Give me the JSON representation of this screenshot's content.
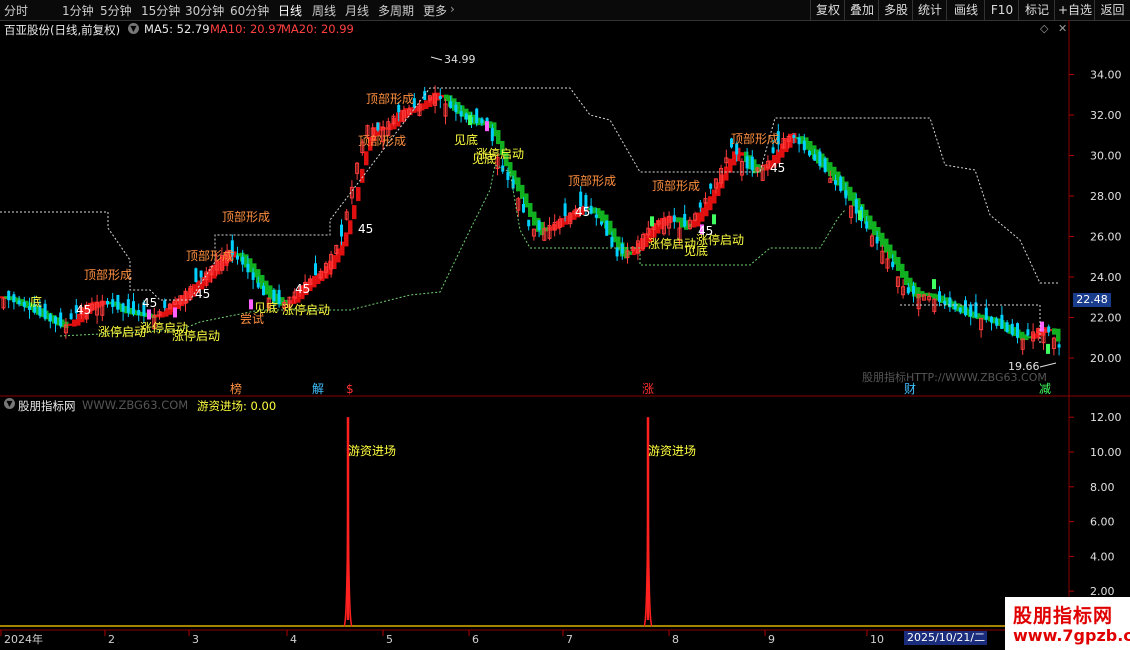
{
  "toolbar": {
    "timeframes": [
      "分时",
      "1分钟",
      "5分钟",
      "15分钟",
      "30分钟",
      "60分钟",
      "日线",
      "周线",
      "月线",
      "多周期",
      "更多"
    ],
    "active_timeframe": "日线",
    "right_buttons": [
      "复权",
      "叠加",
      "多股",
      "统计",
      "画线",
      "F10",
      "标记",
      "+自选",
      "返回"
    ]
  },
  "main_chart": {
    "title": "百亚股份(日线,前复权)",
    "ma5_label": "MA5: 52.79",
    "ma10_label": "MA10: 20.97",
    "ma20_label": "MA20: 20.99",
    "high_label": "34.99",
    "low_label": "19.66",
    "current_price": "22.48",
    "y_ticks": [
      "34.00",
      "32.00",
      "30.00",
      "28.00",
      "26.00",
      "24.00",
      "22.00",
      "20.00"
    ],
    "watermark_text": "股朋指标HTTP://WWW.ZBG63.COM",
    "event_markers": [
      "榜",
      "解",
      "$",
      "涨",
      "财",
      "减"
    ],
    "annotations": [
      "顶部形成",
      "顶部形成",
      "顶部形成",
      "顶部形成",
      "顶部形成",
      "顶部形成",
      "顶部形成",
      "顶部形成",
      "涨停启动",
      "涨停启动",
      "涨停启动",
      "涨停启动",
      "涨停启动",
      "涨停启动",
      "涨停启动",
      "见底",
      "见底",
      "见底",
      "见底",
      "底",
      "尝试",
      "45",
      "45",
      "45",
      "45",
      "45",
      "45",
      "45",
      "45"
    ]
  },
  "indicator": {
    "title": "股朋指标网",
    "site": "WWW.ZBG63.COM",
    "value_label": "游资进场: 0.00",
    "y_ticks": [
      "12.00",
      "10.00",
      "8.00",
      "6.00",
      "4.00",
      "2.00"
    ],
    "spike_labels": [
      "游资进场",
      "游资进场"
    ]
  },
  "x_axis": {
    "labels": [
      "2024年",
      "2",
      "3",
      "4",
      "5",
      "6",
      "7",
      "8",
      "9",
      "10"
    ],
    "current_date": "2025/10/21/二"
  },
  "logo": {
    "line1": "股朋指标网",
    "line2": "www.7gpzb.com"
  },
  "colors": {
    "up": "#ff3c3c",
    "down": "#00d0ff",
    "ribbon_up": "#e01010",
    "ribbon_down": "#10b020",
    "title_fg": "#e8e8e8",
    "ma5": "#e8e8e8",
    "ma10": "#ff4040",
    "ma20": "#ff4040",
    "annotation_top": "#ff9040",
    "annotation_start": "#ffff40",
    "dotted": "#d8d8d8",
    "axis": "#b00000",
    "spike": "#ff2020",
    "base": "#d8b000"
  }
}
